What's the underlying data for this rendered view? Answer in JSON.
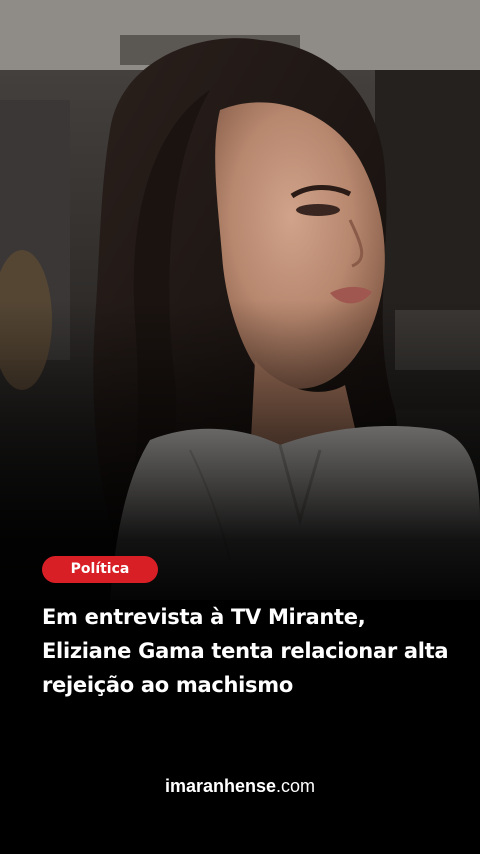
{
  "story": {
    "category": "Política",
    "headline": "Em entrevista à TV Mirante, Eliziane Gama tenta relacionar alta rejeição ao machismo",
    "brand": {
      "name": "imaranhense",
      "tld": ".com"
    }
  },
  "photo": {
    "subject": "woman-with-dark-hair-white-blouse"
  },
  "colors": {
    "badge": "#d91f26",
    "background": "#000000",
    "text": "#ffffff"
  }
}
